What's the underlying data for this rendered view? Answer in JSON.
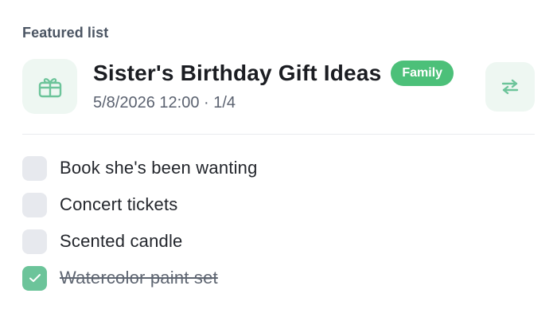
{
  "section": {
    "label": "Featured list"
  },
  "list": {
    "icon": "gift-icon",
    "title": "Sister's Birthday Gift Ideas",
    "badge": "Family",
    "meta": "5/8/2026 12:00 · 1/4",
    "switch_icon": "swap-arrows-icon"
  },
  "items": [
    {
      "label": "Book she's been wanting",
      "checked": false
    },
    {
      "label": "Concert tickets",
      "checked": false
    },
    {
      "label": "Scented candle",
      "checked": false
    },
    {
      "label": "Watercolor paint set",
      "checked": true
    }
  ],
  "colors": {
    "accent": "#4cc079",
    "icon_tint": "#6cc49a",
    "icon_bg": "#eef7f2"
  }
}
